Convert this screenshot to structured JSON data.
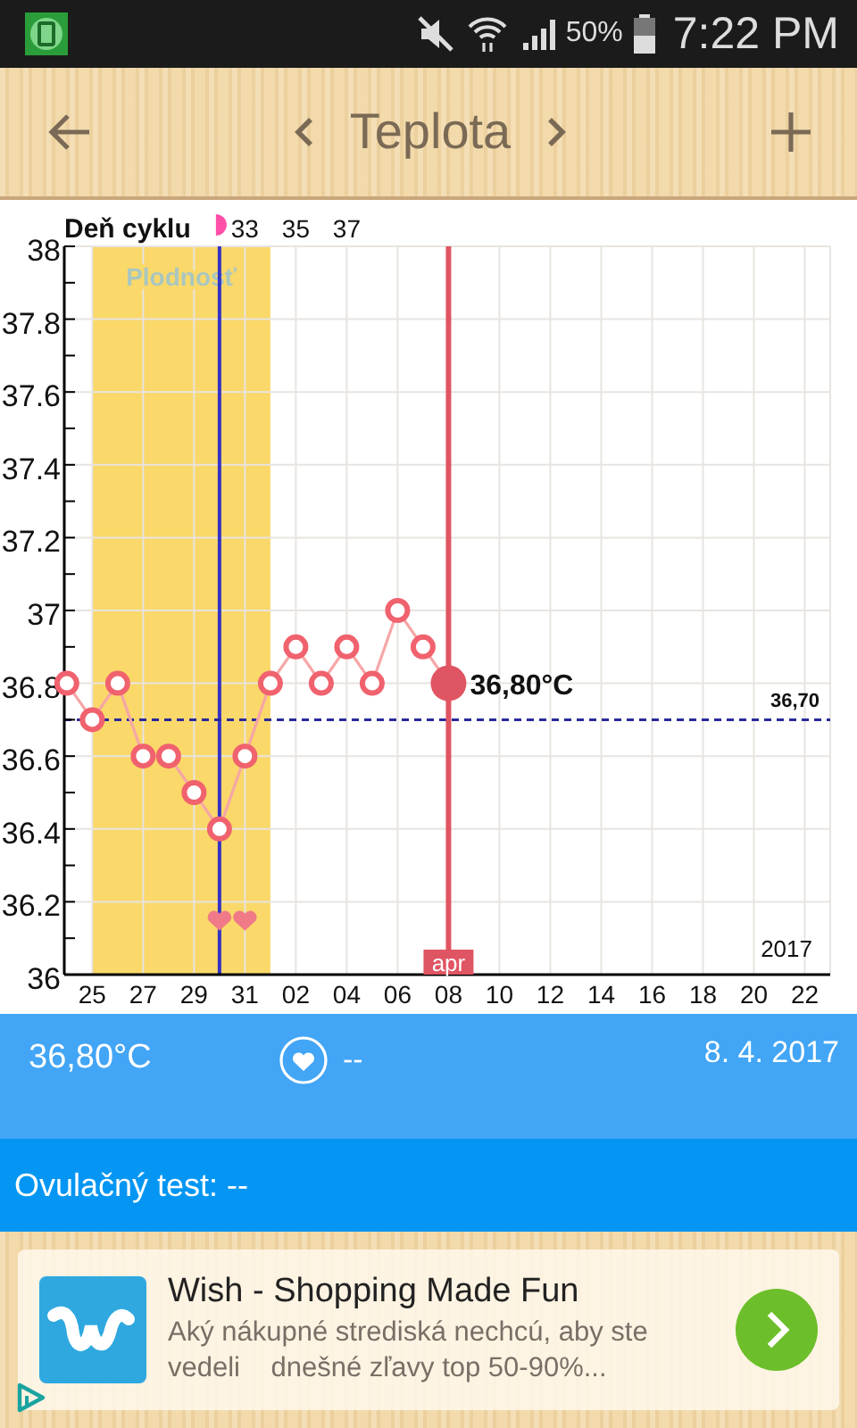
{
  "status_bar": {
    "battery": "50%",
    "time": "7:22 PM"
  },
  "toolbar": {
    "title": "Teplota"
  },
  "chart": {
    "cycle_axis": {
      "label": "Deň cyklu",
      "ticks": [
        "33",
        "35",
        "37"
      ]
    },
    "fertile_window": {
      "label": "Plodnosť"
    },
    "selected_point": {
      "label": "36,80°C",
      "month": "apr"
    },
    "year": "2017",
    "chart_data": {
      "type": "line",
      "categories": [
        null,
        "25",
        null,
        "27",
        null,
        "29",
        null,
        "31",
        null,
        "02",
        null,
        "04",
        null,
        "06",
        null,
        "08",
        null,
        "10",
        null,
        "12",
        null,
        "14",
        null,
        "16",
        null,
        "18",
        null,
        "20",
        null,
        "22"
      ],
      "grid": true,
      "ref_lines": [
        {
          "axis": "y",
          "value": 36.7,
          "label": "36,70",
          "color": "#2a2a9a"
        }
      ],
      "series": [
        {
          "color": "#f0626e",
          "marker": "o",
          "values": [
            36.8,
            36.7,
            36.8,
            36.6,
            36.6,
            36.5,
            36.4,
            36.6,
            36.8,
            36.9,
            36.8,
            36.9,
            36.8,
            37.0,
            36.9,
            36.8,
            null,
            null,
            null,
            null,
            null,
            null,
            null,
            null,
            null,
            null,
            null,
            null,
            null,
            null
          ]
        }
      ],
      "ylim": [
        36,
        38
      ],
      "yticks": [
        {
          "value": 36,
          "label": "36"
        },
        {
          "value": 36.2,
          "label": "36.2"
        },
        {
          "value": 36.4,
          "label": "36.4"
        },
        {
          "value": 36.6,
          "label": "36.6"
        },
        {
          "value": 36.8,
          "label": "36.8"
        },
        {
          "value": 37,
          "label": "37"
        },
        {
          "value": 37.2,
          "label": "37.2"
        },
        {
          "value": 37.4,
          "label": "37.4"
        },
        {
          "value": 37.6,
          "label": "37.6"
        },
        {
          "value": 37.8,
          "label": "37.8"
        },
        {
          "value": 38,
          "label": "38"
        }
      ]
    }
  },
  "summary": {
    "temperature": "36,80°C",
    "intercourse": "--",
    "date": "8. 4. 2017"
  },
  "ovulation_test": "Ovulačný test: --",
  "ad": {
    "title": "Wish - Shopping Made Fun",
    "text": "Aký nákupné strediská nechcú, aby ste vedeli    dnešné zľavy top 50-90%..."
  }
}
